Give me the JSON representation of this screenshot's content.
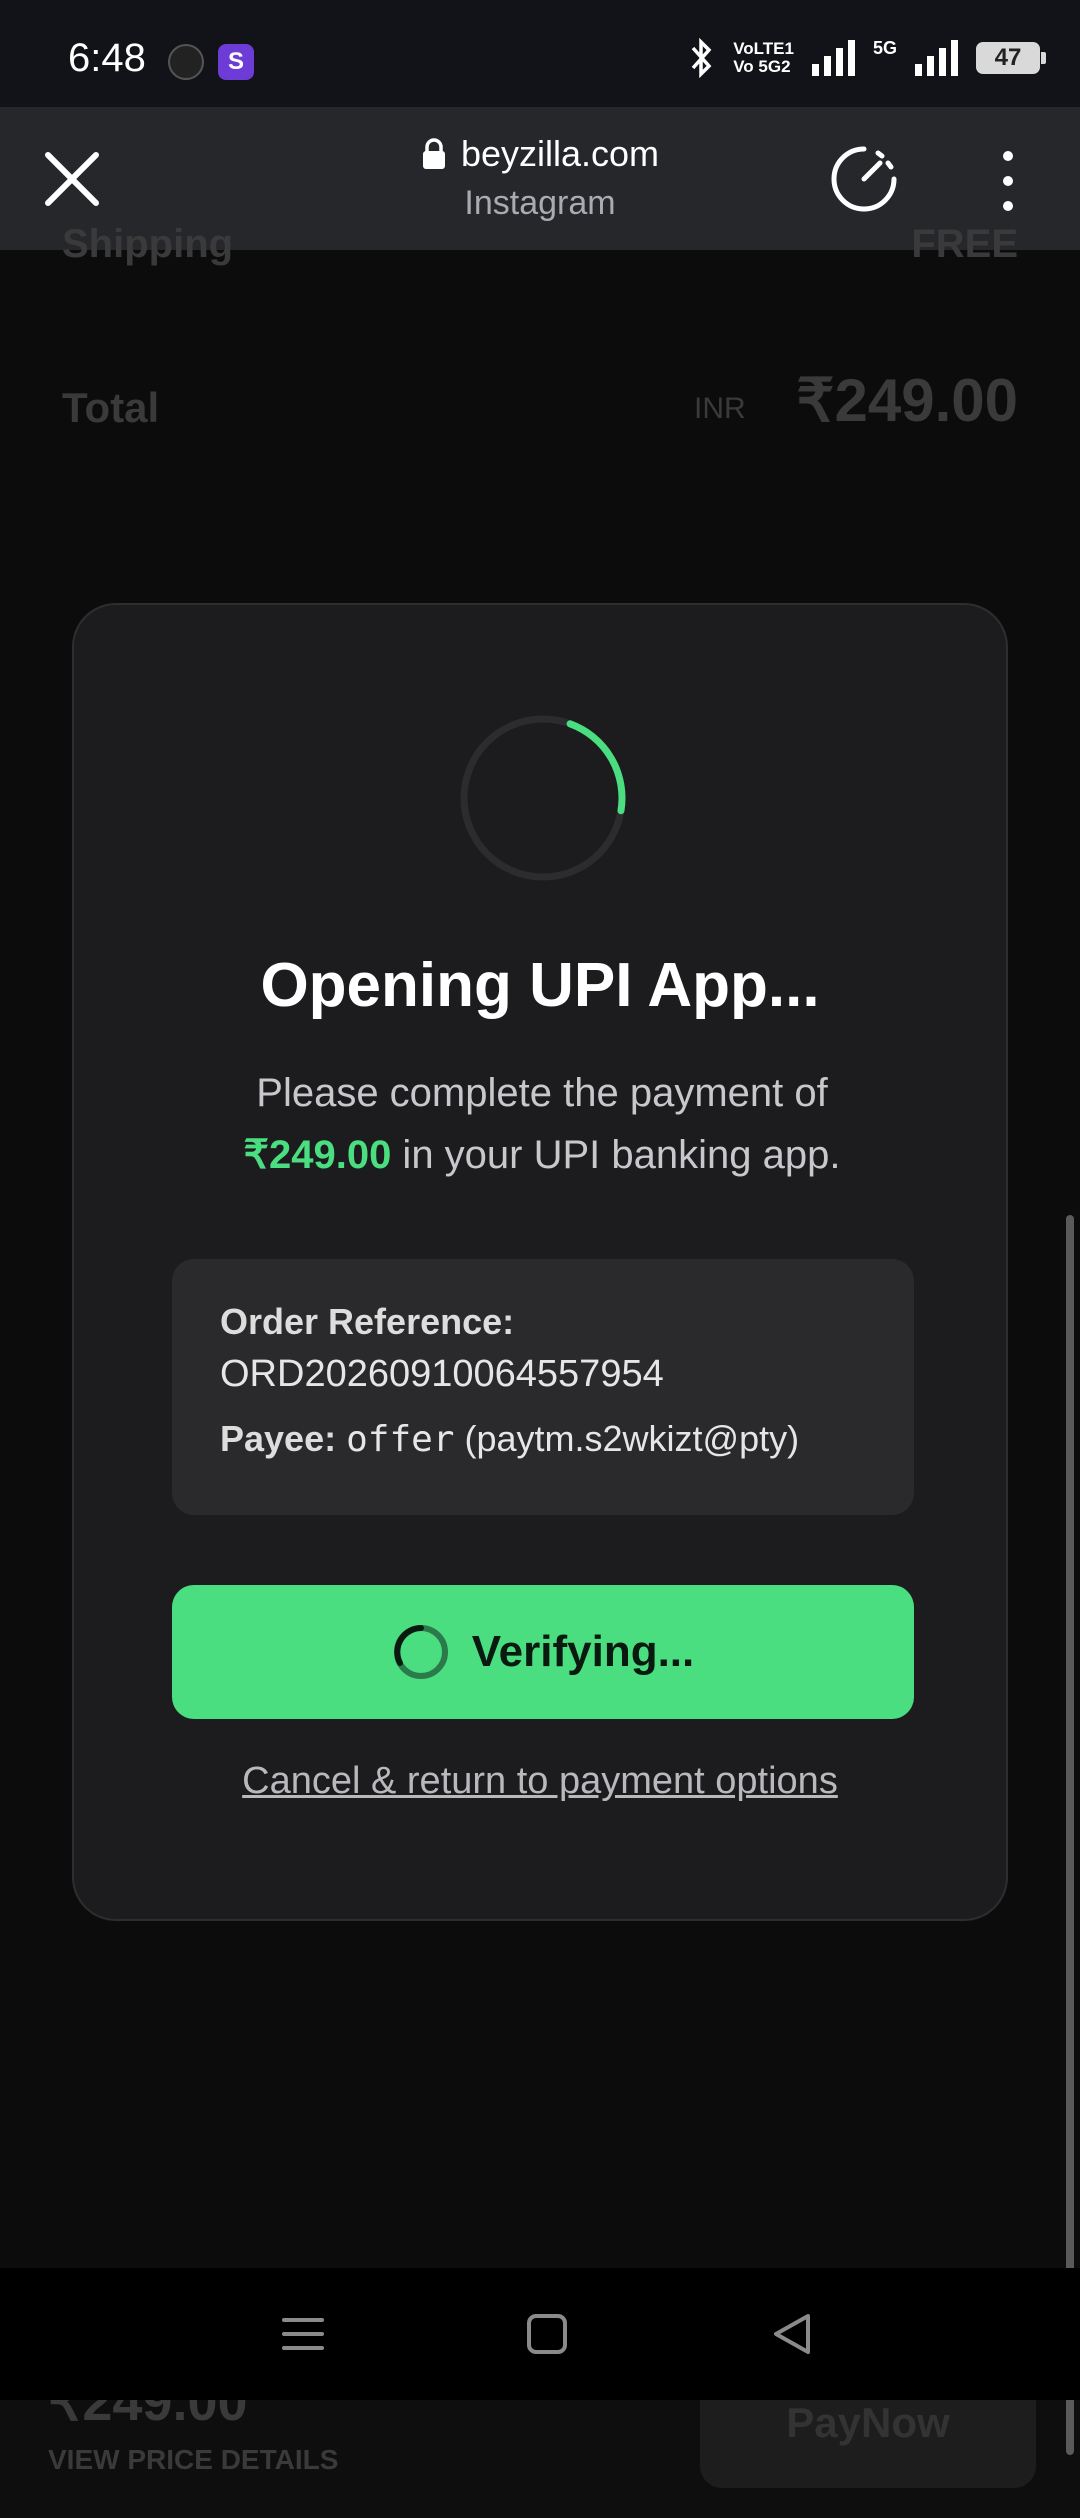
{
  "status_bar": {
    "time": "6:48",
    "network_1": "VoLTE1",
    "network_2": "Vo 5G2",
    "network_5g": "5G",
    "battery": "47"
  },
  "browser": {
    "domain": "beyzilla.com",
    "source": "Instagram"
  },
  "background_page": {
    "shipping_label": "Shipping",
    "shipping_value": "FREE",
    "total_label": "Total",
    "total_currency": "INR",
    "total_value": "₹249.00",
    "bottom_price": "₹249.00",
    "view_details": "VIEW PRICE DETAILS",
    "pay_button": "PayNow"
  },
  "modal": {
    "title": "Opening UPI App...",
    "desc_prefix": "Please complete the payment of",
    "amount": "₹249.00",
    "desc_suffix": " in your UPI banking app.",
    "order_ref_label": "Order Reference:",
    "order_ref_value": "ORD20260910064557954",
    "payee_label": "Payee:",
    "payee_name": "offer",
    "payee_vpa": "(paytm.s2wkizt@pty)",
    "verify_label": "Verifying...",
    "cancel_link": "Cancel & return to payment options",
    "spinner_progress": 0.22
  },
  "colors": {
    "accent_green": "#4ade80",
    "modal_bg": "#1c1c1e"
  }
}
